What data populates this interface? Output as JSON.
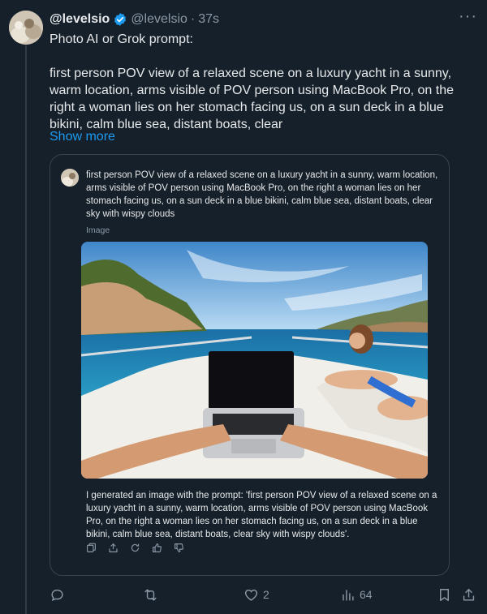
{
  "author": {
    "display_name": "@levelsio",
    "handle": "@levelsio",
    "separator": "·",
    "time": "37s"
  },
  "tweet": {
    "line1": "Photo AI or Grok prompt:",
    "body": "first person POV view of a relaxed scene on a luxury yacht in a sunny, warm location, arms visible of POV person using MacBook Pro, on the right a woman lies on her stomach facing us, on a sun deck in a blue bikini, calm blue sea, distant boats, clear",
    "show_more": "Show more"
  },
  "quote": {
    "prompt": "first person POV view of a relaxed scene on a luxury yacht in a sunny, warm location, arms visible of POV person using MacBook Pro, on the right a woman lies on her stomach facing us, on a sun deck in a blue bikini, calm blue sea, distant boats, clear sky with wispy clouds",
    "image_label": "Image",
    "response": "I generated an image with the prompt: 'first person POV view of a relaxed scene on a luxury yacht in a sunny, warm location, arms visible of POV person using MacBook Pro, on the right a woman lies on her stomach facing us, on a sun deck in a blue bikini, calm blue sea, distant boats, clear sky with wispy clouds'.",
    "actions": [
      "copy-icon",
      "share-icon",
      "regenerate-icon",
      "thumbs-up-icon",
      "thumbs-down-icon"
    ]
  },
  "actions": {
    "reply_icon": "reply-icon",
    "retweet_icon": "retweet-icon",
    "like_icon": "heart-icon",
    "like_count": "2",
    "views_icon": "views-icon",
    "views_count": "64",
    "bookmark_icon": "bookmark-icon",
    "share_icon": "share-icon"
  },
  "colors": {
    "background": "#15202b",
    "text": "#e7e9ea",
    "muted": "#8b98a5",
    "link": "#1d9bf0",
    "border": "#38444d",
    "verified": "#1d9bf0"
  }
}
